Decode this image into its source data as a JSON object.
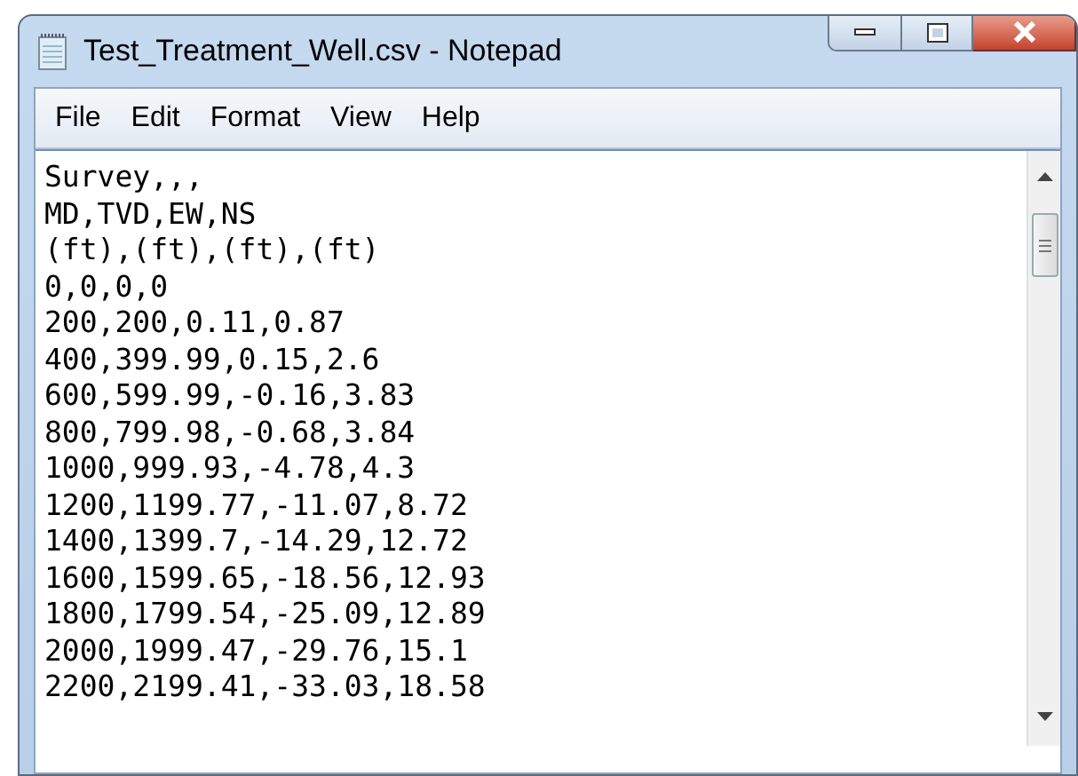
{
  "window": {
    "title": "Test_Treatment_Well.csv - Notepad"
  },
  "menu": [
    {
      "label": "File"
    },
    {
      "label": "Edit"
    },
    {
      "label": "Format"
    },
    {
      "label": "View"
    },
    {
      "label": "Help"
    }
  ],
  "editor": {
    "lines": [
      "Survey,,,",
      "MD,TVD,EW,NS",
      "(ft),(ft),(ft),(ft)",
      "0,0,0,0",
      "200,200,0.11,0.87",
      "400,399.99,0.15,2.6",
      "600,599.99,-0.16,3.83",
      "800,799.98,-0.68,3.84",
      "1000,999.93,-4.78,4.3",
      "1200,1199.77,-11.07,8.72",
      "1400,1399.7,-14.29,12.72",
      "1600,1599.65,-18.56,12.93",
      "1800,1799.54,-25.09,12.89",
      "2000,1999.47,-29.76,15.1",
      "2200,2199.41,-33.03,18.58"
    ]
  }
}
